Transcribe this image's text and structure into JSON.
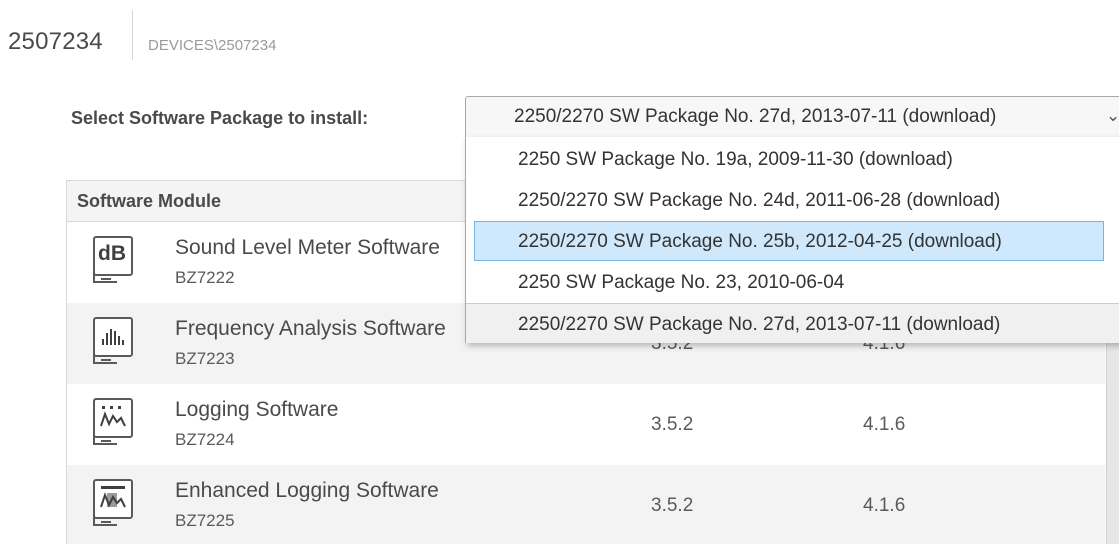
{
  "header": {
    "device_id": "2507234",
    "device_path": "DEVICES\\2507234"
  },
  "select": {
    "label": "Select Software Package to install:",
    "value": "2250/2270 SW Package No. 27d, 2013-07-11  (download)",
    "chevron_icon": "chevron-down-icon",
    "options": [
      "2250 SW Package No. 19a, 2009-11-30  (download)",
      "2250/2270 SW Package No. 24d, 2011-06-28  (download)",
      "2250/2270 SW Package No. 25b, 2012-04-25  (download)",
      "2250 SW Package No. 23, 2010-06-04",
      "2250/2270 SW Package No. 27d, 2013-07-11  (download)"
    ],
    "highlighted_index": 2
  },
  "table": {
    "header_label": "Software Module",
    "rows": [
      {
        "icon": "db-icon",
        "icon_text": "dB",
        "name": "Sound Level Meter Software",
        "code": "BZ7222",
        "version_a": "",
        "version_b": ""
      },
      {
        "icon": "frequency-analysis-icon",
        "name": "Frequency Analysis Software",
        "code": "BZ7223",
        "version_a": "3.5.2",
        "version_b": "4.1.6"
      },
      {
        "icon": "logging-icon",
        "name": "Logging Software",
        "code": "BZ7224",
        "version_a": "3.5.2",
        "version_b": "4.1.6"
      },
      {
        "icon": "enhanced-logging-icon",
        "name": "Enhanced Logging Software",
        "code": "BZ7225",
        "version_a": "3.5.2",
        "version_b": "4.1.6"
      }
    ]
  },
  "colors": {
    "highlight_bg": "#cfe8fb",
    "highlight_border": "#74b5e6",
    "row_alt_bg": "#f3f3f3"
  }
}
